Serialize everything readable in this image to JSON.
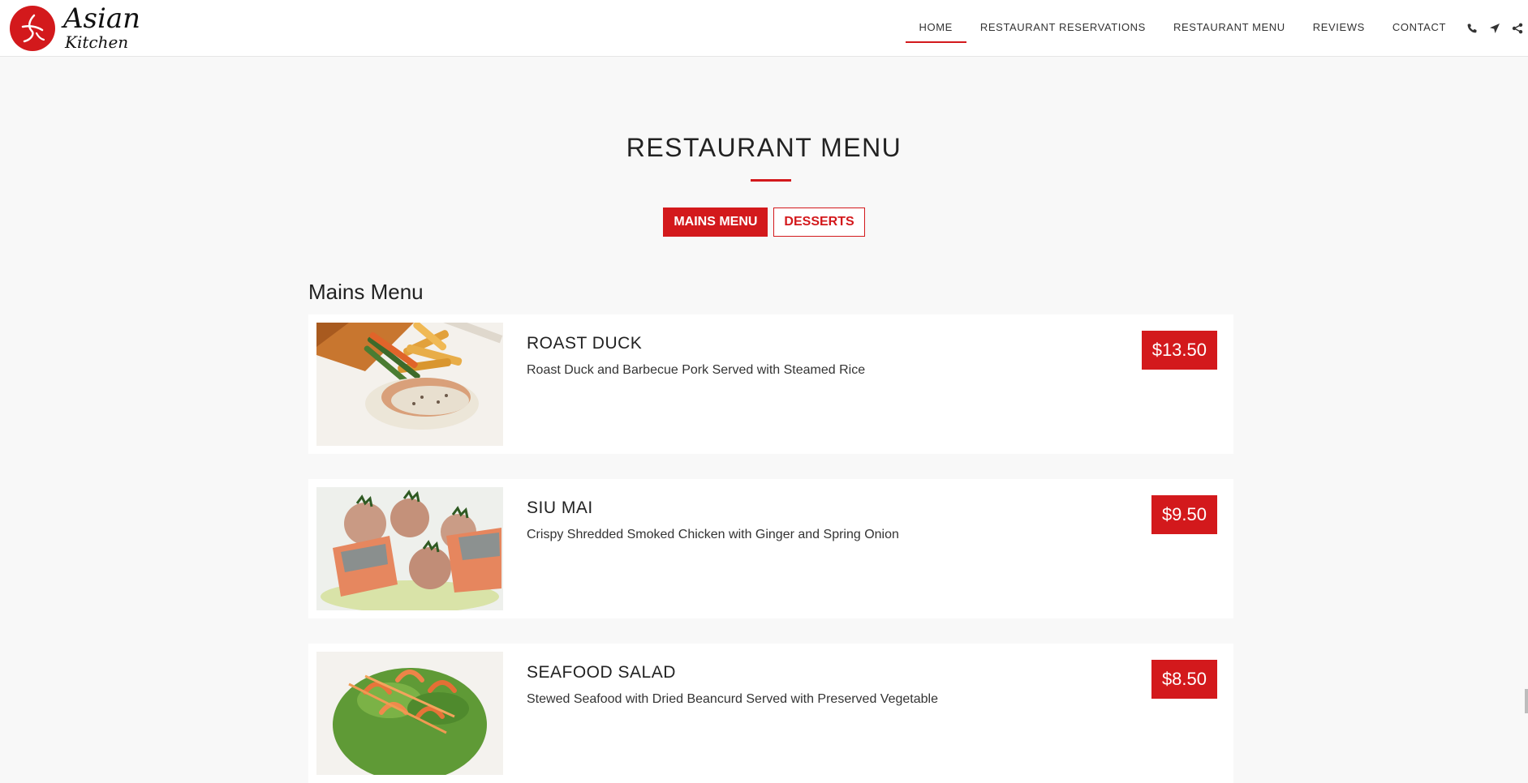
{
  "brand": {
    "line1": "Asian",
    "line2": "Kitchen",
    "accent_color": "#d3191c"
  },
  "nav": {
    "items": [
      {
        "label": "HOME",
        "active": true
      },
      {
        "label": "RESTAURANT RESERVATIONS",
        "active": false
      },
      {
        "label": "RESTAURANT MENU",
        "active": false
      },
      {
        "label": "REVIEWS",
        "active": false
      },
      {
        "label": "CONTACT",
        "active": false
      }
    ],
    "icons": [
      "phone-icon",
      "location-arrow-icon",
      "share-icon"
    ]
  },
  "section": {
    "title": "RESTAURANT MENU",
    "tabs": [
      {
        "label": "MAINS MENU",
        "active": true
      },
      {
        "label": "DESSERTS",
        "active": false
      }
    ],
    "heading": "Mains Menu"
  },
  "menu_items": [
    {
      "name": "ROAST DUCK",
      "description": "Roast Duck and Barbecue Pork Served with Steamed Rice",
      "price": "$13.50",
      "image": "salmon-fries-photo"
    },
    {
      "name": "SIU MAI",
      "description": "Crispy Shredded Smoked Chicken with Ginger and Spring Onion",
      "price": "$9.50",
      "image": "salmon-potatoes-photo"
    },
    {
      "name": "SEAFOOD SALAD",
      "description": "Stewed Seafood with Dried Beancurd Served with Preserved Vegetable",
      "price": "$8.50",
      "image": "shrimp-salad-photo"
    }
  ]
}
